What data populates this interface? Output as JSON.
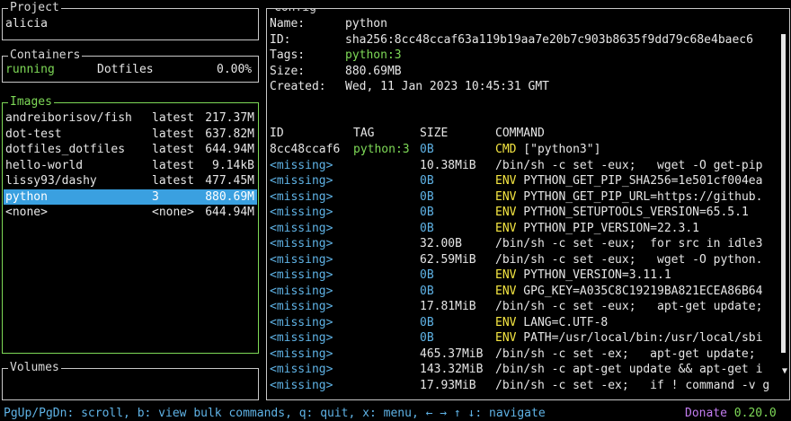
{
  "project": {
    "title": "Project",
    "name": "alicia"
  },
  "containers": {
    "title": "Containers",
    "items": [
      {
        "status": "running",
        "name": "Dotfiles",
        "cpu": "0.00%"
      }
    ]
  },
  "images": {
    "title": "Images",
    "items": [
      {
        "name": "andreiborisov/fish",
        "tag": "latest",
        "size": "217.37M"
      },
      {
        "name": "dot-test",
        "tag": "latest",
        "size": "637.82M"
      },
      {
        "name": "dotfiles_dotfiles",
        "tag": "latest",
        "size": "644.94M"
      },
      {
        "name": "hello-world",
        "tag": "latest",
        "size": "9.14kB"
      },
      {
        "name": "lissy93/dashy",
        "tag": "latest",
        "size": "477.45M"
      },
      {
        "name": "python",
        "tag": "3",
        "size": "880.69M"
      },
      {
        "name": "<none>",
        "tag": "<none>",
        "size": "644.94M"
      }
    ],
    "selected_index": 5
  },
  "volumes": {
    "title": "Volumes"
  },
  "config": {
    "title": "Config",
    "name_label": "Name:",
    "name": "python",
    "id_label": "ID:",
    "id": "sha256:8cc48ccaf63a119b19aa7e20b7c903b8635f9dd79c68e4baec6",
    "tags_label": "Tags:",
    "tags": "python:3",
    "size_label": "Size:",
    "size": "880.69MB",
    "created_label": "Created:",
    "created": "Wed, 11 Jan 2023 10:45:31 GMT",
    "history_headers": {
      "id": "ID",
      "tag": "TAG",
      "size": "SIZE",
      "command": "COMMAND"
    },
    "history": [
      {
        "id": "8cc48ccaf6",
        "tag": "python:3",
        "size": "0B",
        "kw": "CMD",
        "cmd": " [\"python3\"]"
      },
      {
        "id": "<missing>",
        "tag": "",
        "size": "10.38MiB",
        "kw": "",
        "cmd": "/bin/sh -c set -eux;   wget -O get-pip"
      },
      {
        "id": "<missing>",
        "tag": "",
        "size": "0B",
        "kw": "ENV",
        "cmd": " PYTHON_GET_PIP_SHA256=1e501cf004ea"
      },
      {
        "id": "<missing>",
        "tag": "",
        "size": "0B",
        "kw": "ENV",
        "cmd": " PYTHON_GET_PIP_URL=https://github."
      },
      {
        "id": "<missing>",
        "tag": "",
        "size": "0B",
        "kw": "ENV",
        "cmd": " PYTHON_SETUPTOOLS_VERSION=65.5.1"
      },
      {
        "id": "<missing>",
        "tag": "",
        "size": "0B",
        "kw": "ENV",
        "cmd": " PYTHON_PIP_VERSION=22.3.1"
      },
      {
        "id": "<missing>",
        "tag": "",
        "size": "32.00B",
        "kw": "",
        "cmd": "/bin/sh -c set -eux;  for src in idle3"
      },
      {
        "id": "<missing>",
        "tag": "",
        "size": "62.59MiB",
        "kw": "",
        "cmd": "/bin/sh -c set -eux;   wget -O python."
      },
      {
        "id": "<missing>",
        "tag": "",
        "size": "0B",
        "kw": "ENV",
        "cmd": " PYTHON_VERSION=3.11.1"
      },
      {
        "id": "<missing>",
        "tag": "",
        "size": "0B",
        "kw": "ENV",
        "cmd": " GPG_KEY=A035C8C19219BA821ECEA86B64"
      },
      {
        "id": "<missing>",
        "tag": "",
        "size": "17.81MiB",
        "kw": "",
        "cmd": "/bin/sh -c set -eux;   apt-get update;"
      },
      {
        "id": "<missing>",
        "tag": "",
        "size": "0B",
        "kw": "ENV",
        "cmd": " LANG=C.UTF-8"
      },
      {
        "id": "<missing>",
        "tag": "",
        "size": "0B",
        "kw": "ENV",
        "cmd": " PATH=/usr/local/bin:/usr/local/sbi"
      },
      {
        "id": "<missing>",
        "tag": "",
        "size": "465.37MiB",
        "kw": "",
        "cmd": "/bin/sh -c set -ex;   apt-get update;"
      },
      {
        "id": "<missing>",
        "tag": "",
        "size": "143.32MiB",
        "kw": "",
        "cmd": "/bin/sh -c apt-get update && apt-get i"
      },
      {
        "id": "<missing>",
        "tag": "",
        "size": "17.93MiB",
        "kw": "",
        "cmd": "/bin/sh -c set -ex;   if ! command -v g"
      }
    ],
    "scroll_down_arrow": "▼"
  },
  "status_bar": {
    "help": "PgUp/PgDn: scroll, b: view bulk commands, q: quit, x: menu, ← → ↑ ↓: navigate",
    "donate": "Donate",
    "version": "0.20.0"
  },
  "colors": {
    "active_border": "#7ed957",
    "selection": "#3aa0e0",
    "id_blue": "#5fb3e6",
    "keyword_yellow": "#f5e642",
    "donate_violet": "#c27cf0"
  }
}
